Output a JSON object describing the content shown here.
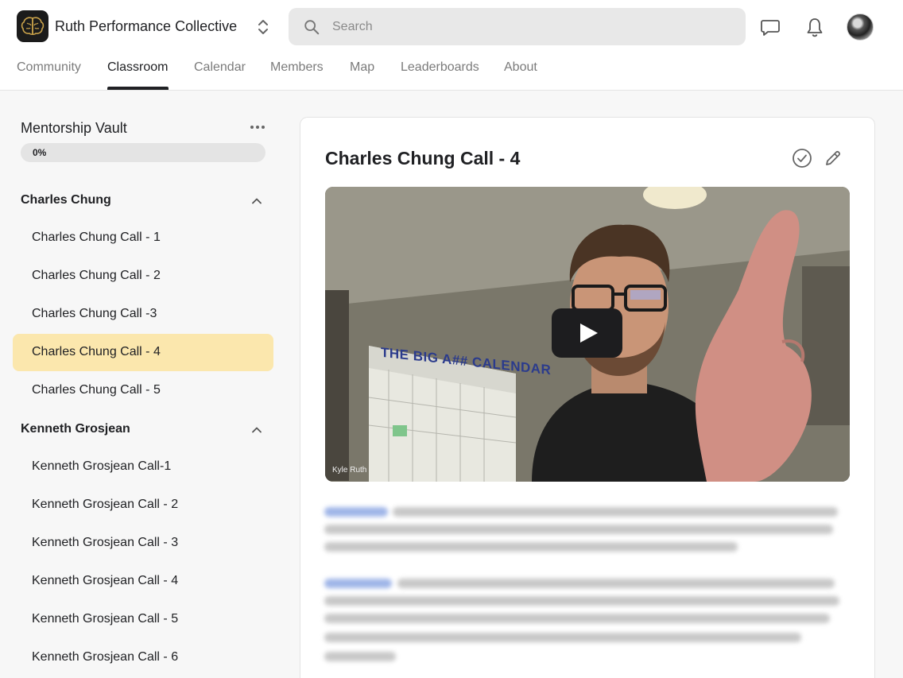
{
  "header": {
    "group_name": "Ruth Performance Collective",
    "search_placeholder": "Search",
    "tabs": [
      {
        "label": "Community"
      },
      {
        "label": "Classroom"
      },
      {
        "label": "Calendar"
      },
      {
        "label": "Members"
      },
      {
        "label": "Map"
      },
      {
        "label": "Leaderboards"
      },
      {
        "label": "About"
      }
    ],
    "active_tab": "Classroom"
  },
  "sidebar": {
    "course_title": "Mentorship Vault",
    "progress": {
      "value": 0,
      "label": "0%"
    },
    "sections": [
      {
        "title": "Charles Chung",
        "lessons": [
          {
            "label": "Charles Chung Call - 1"
          },
          {
            "label": "Charles Chung Call - 2"
          },
          {
            "label": "Charles Chung Call -3"
          },
          {
            "label": "Charles Chung Call - 4",
            "active": true
          },
          {
            "label": "Charles Chung Call - 5"
          }
        ]
      },
      {
        "title": "Kenneth Grosjean",
        "lessons": [
          {
            "label": "Kenneth Grosjean Call-1"
          },
          {
            "label": "Kenneth Grosjean Call - 2"
          },
          {
            "label": "Kenneth Grosjean Call - 3"
          },
          {
            "label": "Kenneth Grosjean Call - 4"
          },
          {
            "label": "Kenneth Grosjean Call - 5"
          },
          {
            "label": "Kenneth Grosjean Call - 6"
          }
        ]
      }
    ]
  },
  "main": {
    "lesson_title": "Charles Chung Call - 4",
    "video": {
      "overlay_name": "Kyle Ruth",
      "wall_text": "THE BIG A## CALENDAR"
    }
  },
  "colors": {
    "active_lesson_bg": "#fbe7ad",
    "active_tab": "#202124",
    "inactive_tab": "#7b7b7b"
  }
}
